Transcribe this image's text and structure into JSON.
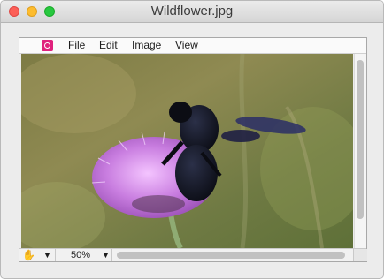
{
  "window": {
    "title": "Wildflower.jpg"
  },
  "menu": {
    "app_icon": "app-icon",
    "items": [
      "File",
      "Edit",
      "Image",
      "View"
    ]
  },
  "image": {
    "subject": "bee-on-thistle-photo"
  },
  "statusbar": {
    "tool_icon": "hand-icon",
    "zoom": "50%"
  },
  "colors": {
    "close": "#fc5f57",
    "minimize": "#fdbc2e",
    "zoom": "#28c840",
    "app_icon": "#e0217d"
  }
}
